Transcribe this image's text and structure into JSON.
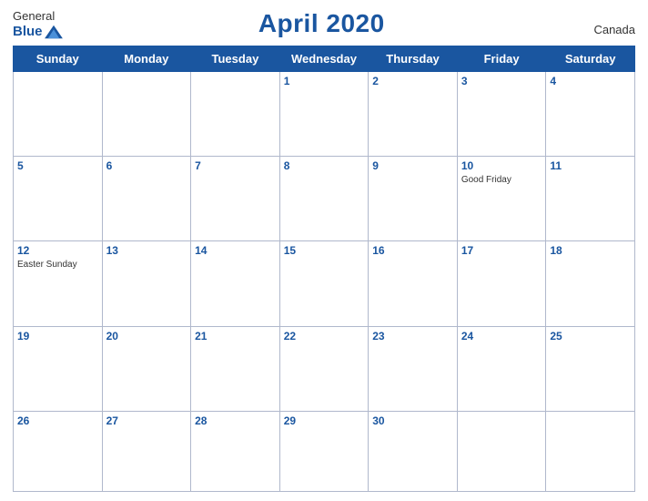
{
  "header": {
    "logo": {
      "general": "General",
      "blue": "Blue",
      "icon_shape": "triangle"
    },
    "title": "April 2020",
    "country": "Canada"
  },
  "weekdays": [
    "Sunday",
    "Monday",
    "Tuesday",
    "Wednesday",
    "Thursday",
    "Friday",
    "Saturday"
  ],
  "weeks": [
    [
      {
        "day": "",
        "event": ""
      },
      {
        "day": "",
        "event": ""
      },
      {
        "day": "",
        "event": ""
      },
      {
        "day": "1",
        "event": ""
      },
      {
        "day": "2",
        "event": ""
      },
      {
        "day": "3",
        "event": ""
      },
      {
        "day": "4",
        "event": ""
      }
    ],
    [
      {
        "day": "5",
        "event": ""
      },
      {
        "day": "6",
        "event": ""
      },
      {
        "day": "7",
        "event": ""
      },
      {
        "day": "8",
        "event": ""
      },
      {
        "day": "9",
        "event": ""
      },
      {
        "day": "10",
        "event": "Good Friday"
      },
      {
        "day": "11",
        "event": ""
      }
    ],
    [
      {
        "day": "12",
        "event": "Easter Sunday"
      },
      {
        "day": "13",
        "event": ""
      },
      {
        "day": "14",
        "event": ""
      },
      {
        "day": "15",
        "event": ""
      },
      {
        "day": "16",
        "event": ""
      },
      {
        "day": "17",
        "event": ""
      },
      {
        "day": "18",
        "event": ""
      }
    ],
    [
      {
        "day": "19",
        "event": ""
      },
      {
        "day": "20",
        "event": ""
      },
      {
        "day": "21",
        "event": ""
      },
      {
        "day": "22",
        "event": ""
      },
      {
        "day": "23",
        "event": ""
      },
      {
        "day": "24",
        "event": ""
      },
      {
        "day": "25",
        "event": ""
      }
    ],
    [
      {
        "day": "26",
        "event": ""
      },
      {
        "day": "27",
        "event": ""
      },
      {
        "day": "28",
        "event": ""
      },
      {
        "day": "29",
        "event": ""
      },
      {
        "day": "30",
        "event": ""
      },
      {
        "day": "",
        "event": ""
      },
      {
        "day": "",
        "event": ""
      }
    ]
  ]
}
